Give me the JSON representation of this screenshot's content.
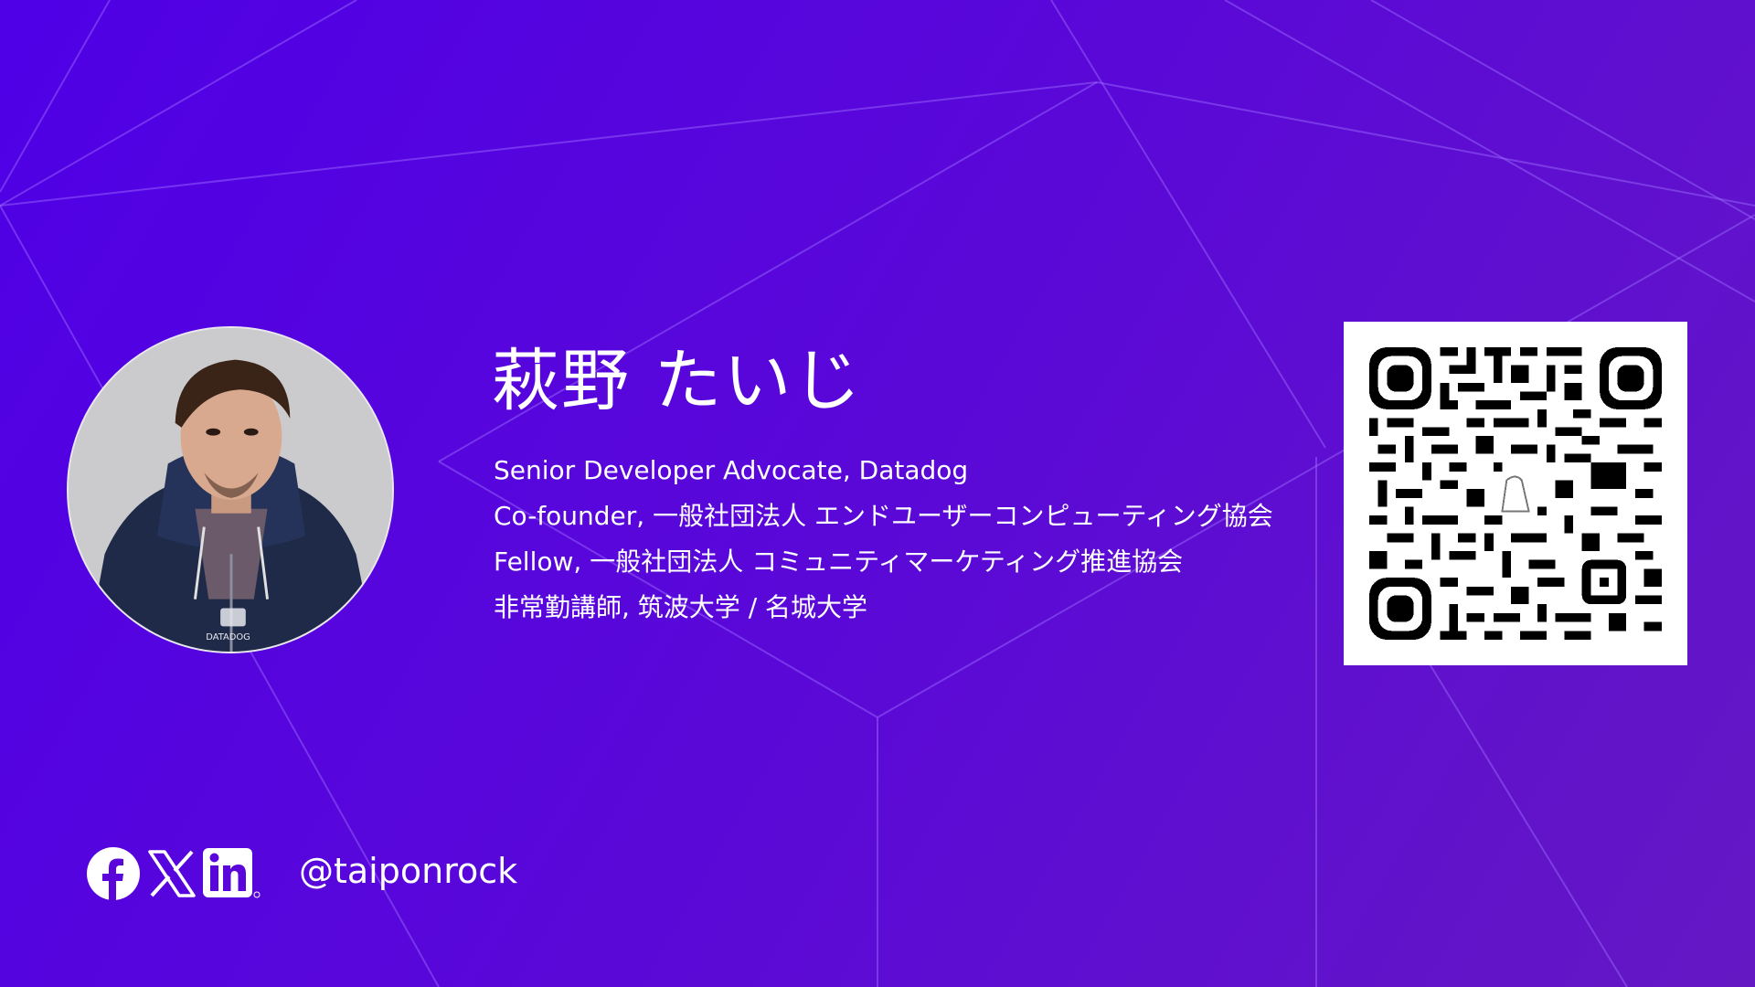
{
  "profile": {
    "name": "萩野 たいじ",
    "titles": [
      "Senior Developer Advocate, Datadog",
      "Co-founder, 一般社団法人 エンドユーザーコンピューティング協会",
      "Fellow, 一般社団法人 コミュニティマーケティング推進協会",
      "非常勤講師, 筑波大学 / 名城大学"
    ],
    "photo": "portrait-photo",
    "shirt_logo_text": "DATADOG"
  },
  "social": {
    "icons": [
      "facebook-icon",
      "x-icon",
      "linkedin-icon"
    ],
    "handle": "@taiponrock"
  },
  "qr": {
    "icon": "qr-code",
    "center_logo": "datadog-logo"
  },
  "colors": {
    "background_start": "#4f00e6",
    "background_end": "#6418c4",
    "text": "#ffffff",
    "qr_fg": "#000000",
    "qr_bg": "#ffffff"
  }
}
